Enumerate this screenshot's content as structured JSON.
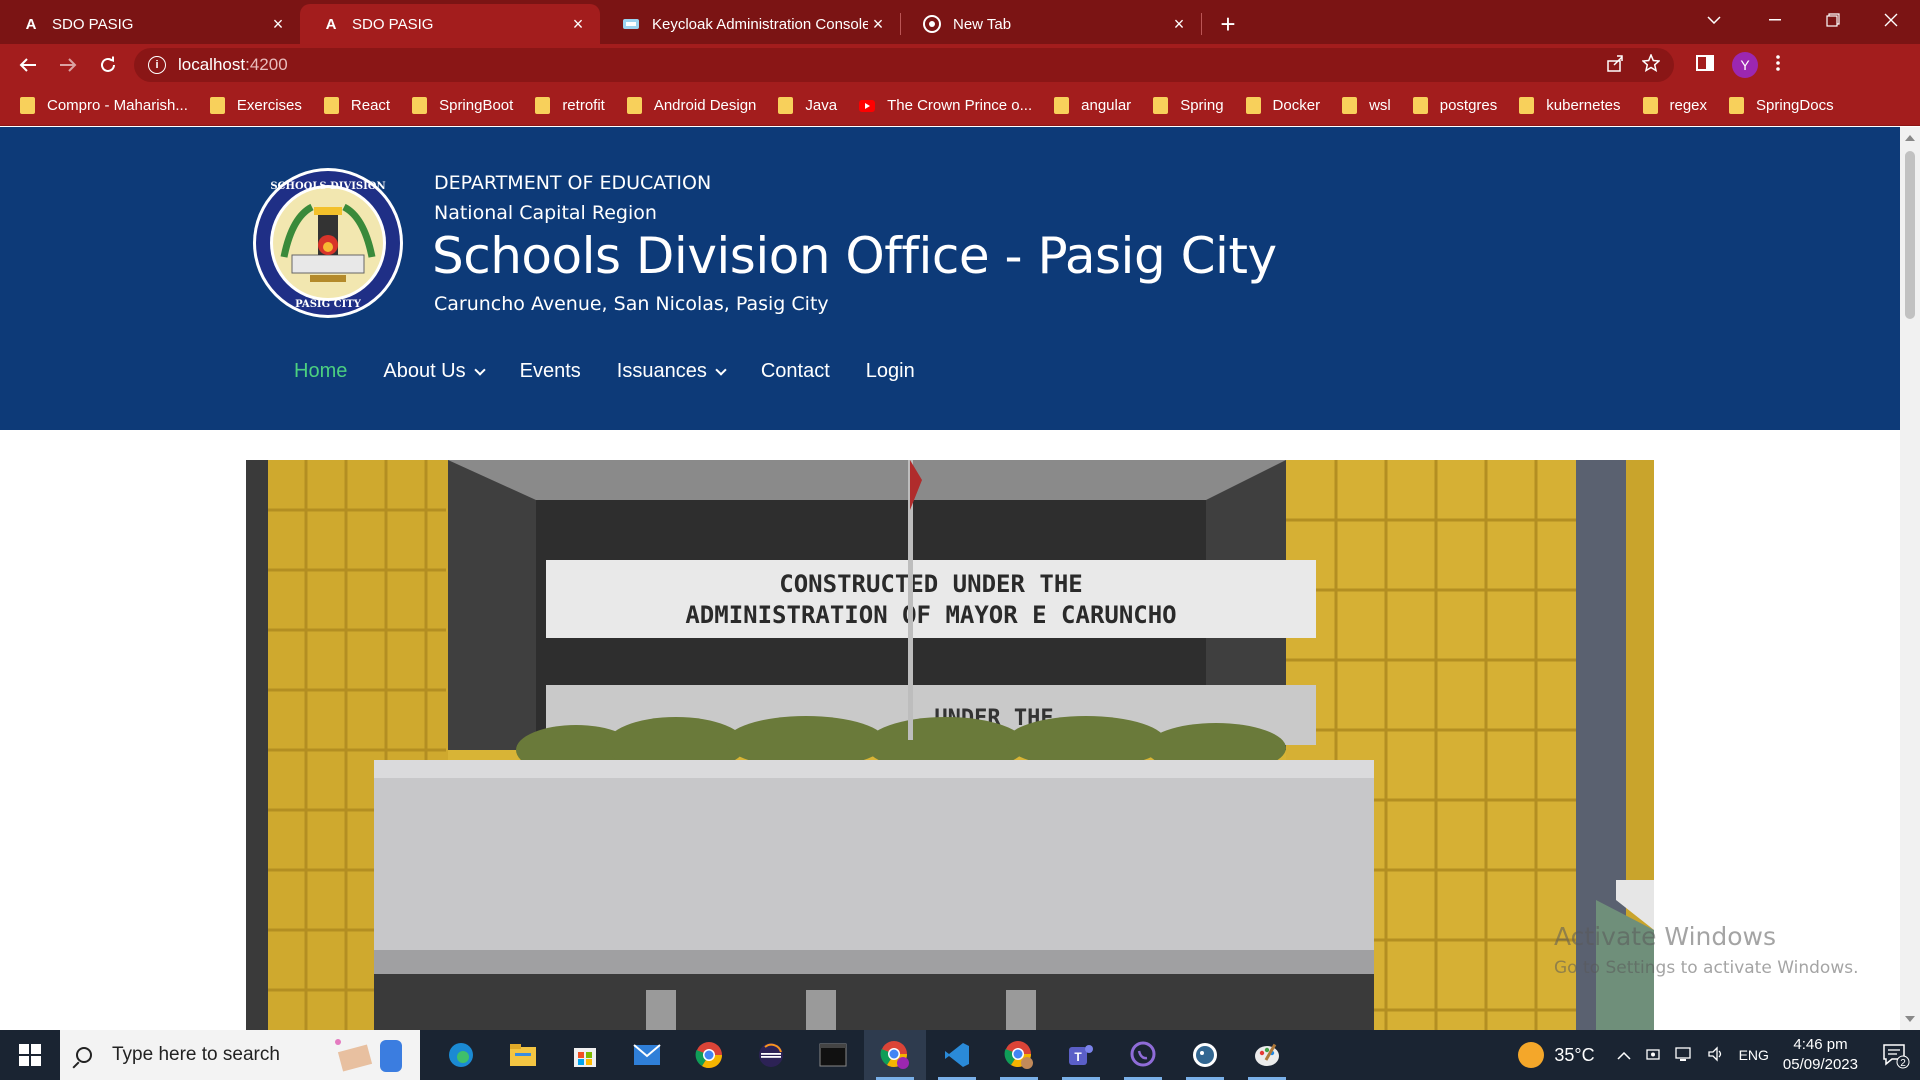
{
  "browser": {
    "tabs": [
      {
        "title": "SDO PASIG",
        "favicon": "angular-icon",
        "active": false
      },
      {
        "title": "SDO PASIG",
        "favicon": "angular-icon",
        "active": true
      },
      {
        "title": "Keycloak Administration Console",
        "favicon": "keycloak-icon",
        "active": false
      },
      {
        "title": "New Tab",
        "favicon": "chrome-icon",
        "active": false
      }
    ],
    "url_host": "localhost",
    "url_port": ":4200",
    "profile_initial": "Y",
    "bookmarks": [
      {
        "label": "Compro - Maharish...",
        "type": "folder"
      },
      {
        "label": "Exercises",
        "type": "folder"
      },
      {
        "label": "React",
        "type": "folder"
      },
      {
        "label": "SpringBoot",
        "type": "folder"
      },
      {
        "label": "retrofit",
        "type": "folder"
      },
      {
        "label": "Android Design",
        "type": "folder"
      },
      {
        "label": "Java",
        "type": "folder"
      },
      {
        "label": "The Crown Prince o...",
        "type": "youtube"
      },
      {
        "label": "angular",
        "type": "folder"
      },
      {
        "label": "Spring",
        "type": "folder"
      },
      {
        "label": "Docker",
        "type": "folder"
      },
      {
        "label": "wsl",
        "type": "folder"
      },
      {
        "label": "postgres",
        "type": "folder"
      },
      {
        "label": "kubernetes",
        "type": "folder"
      },
      {
        "label": "regex",
        "type": "folder"
      },
      {
        "label": "SpringDocs",
        "type": "folder"
      }
    ]
  },
  "site": {
    "department": "DEPARTMENT OF EDUCATION",
    "region": "National Capital Region",
    "title": "Schools Division Office - Pasig City",
    "address": "Caruncho Avenue, San Nicolas, Pasig City",
    "nav": [
      {
        "label": "Home",
        "active": true,
        "dropdown": false
      },
      {
        "label": "About Us",
        "active": false,
        "dropdown": true
      },
      {
        "label": "Events",
        "active": false,
        "dropdown": false
      },
      {
        "label": "Issuances",
        "active": false,
        "dropdown": true
      },
      {
        "label": "Contact",
        "active": false,
        "dropdown": false
      },
      {
        "label": "Login",
        "active": false,
        "dropdown": false
      }
    ],
    "hero_sign_line1": "CONSTRUCTED UNDER THE",
    "hero_sign_line2": "ADMINISTRATION OF MAYOR E CARUNCHO",
    "hero_sign_partial": "UNDER THE"
  },
  "watermark": {
    "line1": "Activate Windows",
    "line2": "Go to Settings to activate Windows."
  },
  "taskbar": {
    "search_placeholder": "Type here to search",
    "temperature": "35°C",
    "language": "ENG",
    "time": "4:46 pm",
    "date": "05/09/2023",
    "notification_count": "2",
    "apps": [
      "edge-icon",
      "file-explorer-icon",
      "microsoft-store-icon",
      "mail-icon",
      "chrome-icon",
      "eclipse-icon",
      "terminal-icon",
      "chrome-profile-icon",
      "vscode-icon",
      "chrome-alt-icon",
      "teams-icon",
      "viber-icon",
      "pgadmin-icon",
      "paint-icon"
    ]
  },
  "colors": {
    "browser_frame": "#7b1414",
    "browser_toolbar": "#a31d1d",
    "site_header": "#0d3a78",
    "nav_active": "#4cd080",
    "taskbar": "#1a2432"
  }
}
